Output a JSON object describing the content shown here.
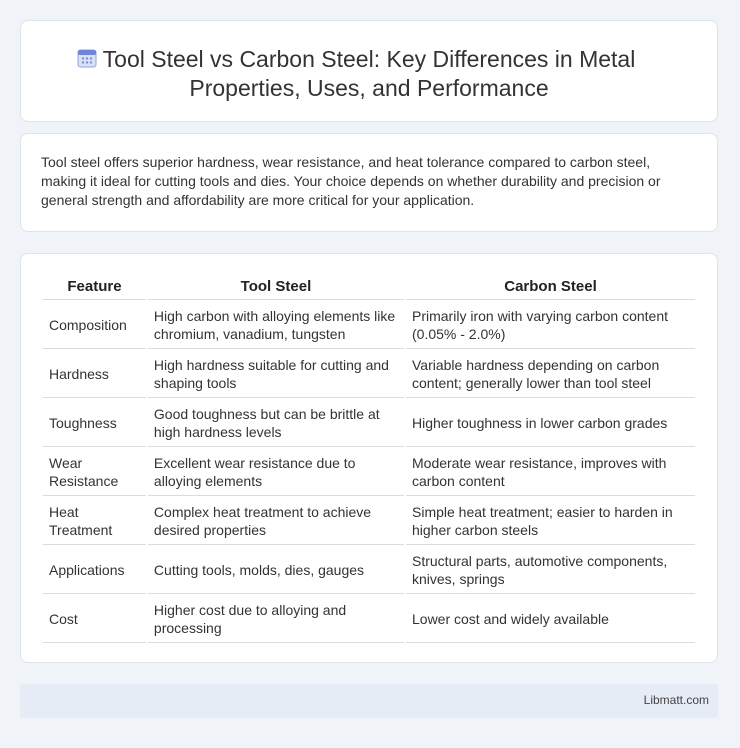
{
  "header": {
    "icon": "calendar-grid-icon",
    "title": "Tool Steel vs Carbon Steel: Key Differences in Metal Properties, Uses, and Performance"
  },
  "intro": {
    "text": "Tool steel offers superior hardness, wear resistance, and heat tolerance compared to carbon steel, making it ideal for cutting tools and dies. Your choice depends on whether durability and precision or general strength and affordability are more critical for your application."
  },
  "table": {
    "headers": [
      "Feature",
      "Tool Steel",
      "Carbon Steel"
    ],
    "rows": [
      [
        "Composition",
        "High carbon with alloying elements like chromium, vanadium, tungsten",
        "Primarily iron with varying carbon content (0.05% - 2.0%)"
      ],
      [
        "Hardness",
        "High hardness suitable for cutting and shaping tools",
        "Variable hardness depending on carbon content; generally lower than tool steel"
      ],
      [
        "Toughness",
        "Good toughness but can be brittle at high hardness levels",
        "Higher toughness in lower carbon grades"
      ],
      [
        "Wear Resistance",
        "Excellent wear resistance due to alloying elements",
        "Moderate wear resistance, improves with carbon content"
      ],
      [
        "Heat Treatment",
        "Complex heat treatment to achieve desired properties",
        "Simple heat treatment; easier to harden in higher carbon steels"
      ],
      [
        "Applications",
        "Cutting tools, molds, dies, gauges",
        "Structural parts, automotive components, knives, springs"
      ],
      [
        "Cost",
        "Higher cost due to alloying and processing",
        "Lower cost and widely available"
      ]
    ]
  },
  "footer": {
    "text": "Libmatt.com"
  }
}
